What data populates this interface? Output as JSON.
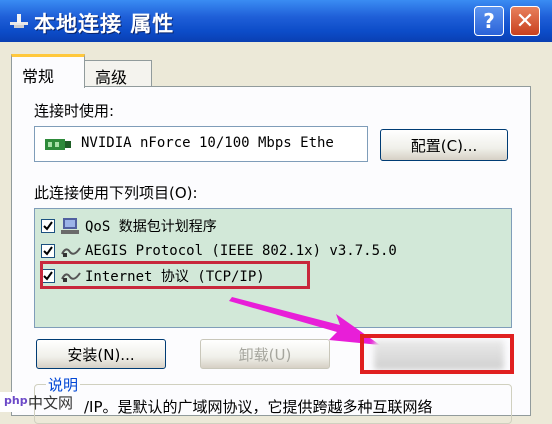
{
  "window": {
    "title": "本地连接 属性",
    "help_label": "?",
    "close_label": "✕"
  },
  "tabs": [
    {
      "label": "常规"
    },
    {
      "label": "高级"
    }
  ],
  "connect_using": {
    "label": "连接时使用:",
    "adapter": "NVIDIA nForce 10/100 Mbps Ethe",
    "configure_label": "配置(C)..."
  },
  "items_section": {
    "label": "此连接使用下列项目(O):",
    "items": [
      {
        "text": "QoS 数据包计划程序",
        "checked": true,
        "icon": "qos-network-icon"
      },
      {
        "text": "AEGIS Protocol (IEEE 802.1x) v3.7.5.0",
        "checked": true,
        "icon": "protocol-icon"
      },
      {
        "text": "Internet 协议 (TCP/IP)",
        "checked": true,
        "icon": "protocol-icon"
      }
    ]
  },
  "buttons": {
    "install": "安装(N)...",
    "uninstall": "卸载(U)"
  },
  "description": {
    "label": "说明",
    "text": "/IP。是默认的广域网协议，它提供跨越多种互联网络"
  },
  "watermark": {
    "brand": "php",
    "text": "中文网"
  },
  "colors": {
    "highlight": "#C8283C",
    "arrow": "#E81ED8",
    "red_box": "#E02020"
  }
}
